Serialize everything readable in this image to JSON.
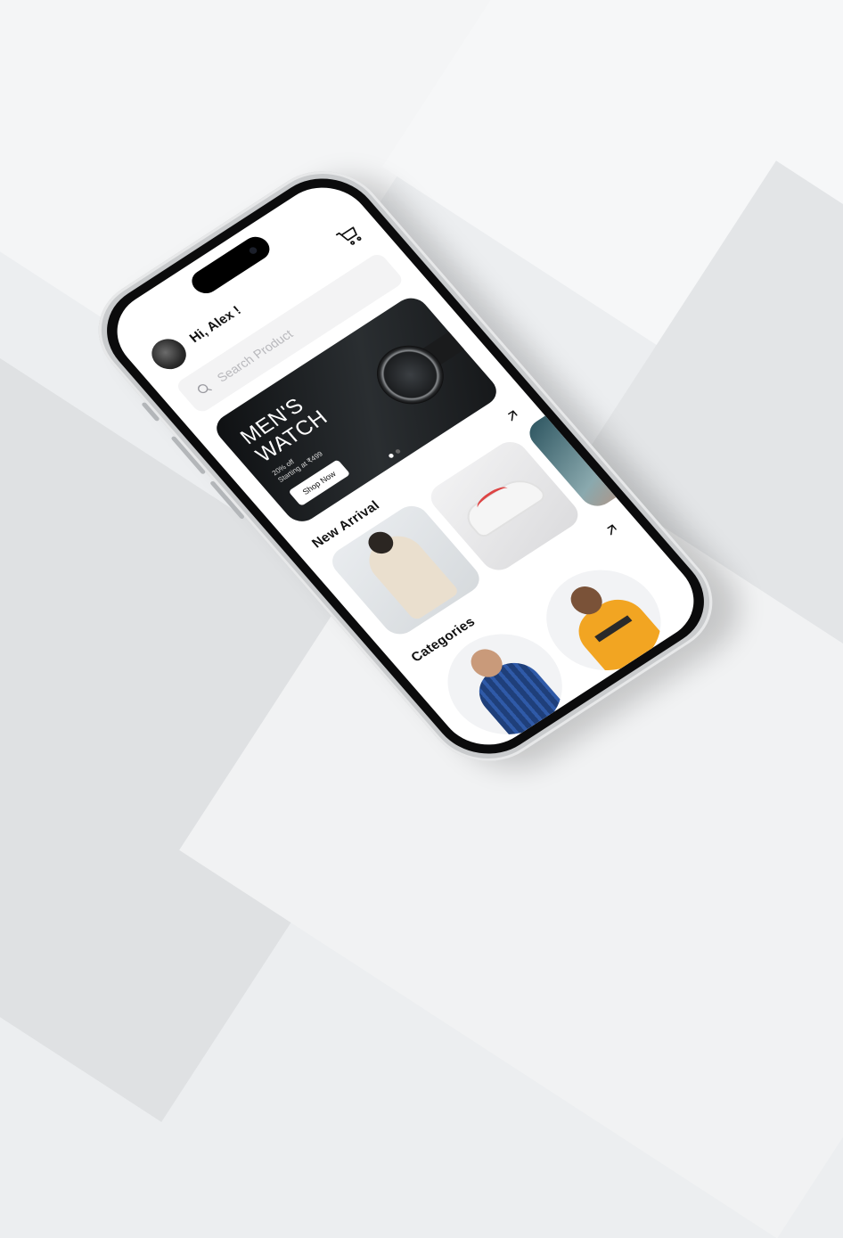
{
  "header": {
    "greeting": "Hi, Alex !",
    "cart_icon": "cart-icon",
    "avatar_icon": "avatar"
  },
  "search": {
    "placeholder": "Search Product",
    "icon": "search-icon"
  },
  "banner": {
    "title": "MEN'S WATCH",
    "discount": "20% off",
    "price_text": "Starting at ₹499",
    "button_label": "Shop Now",
    "dots": 2,
    "active_dot": 0
  },
  "new_arrival": {
    "title": "New Arrival",
    "arrow_icon": "arrow-up-right-icon"
  },
  "categories": {
    "title": "Categories",
    "arrow_icon": "arrow-up-right-icon"
  },
  "colors": {
    "accent": "#1ea7d8",
    "dark": "#111111",
    "surface": "#ffffff"
  }
}
